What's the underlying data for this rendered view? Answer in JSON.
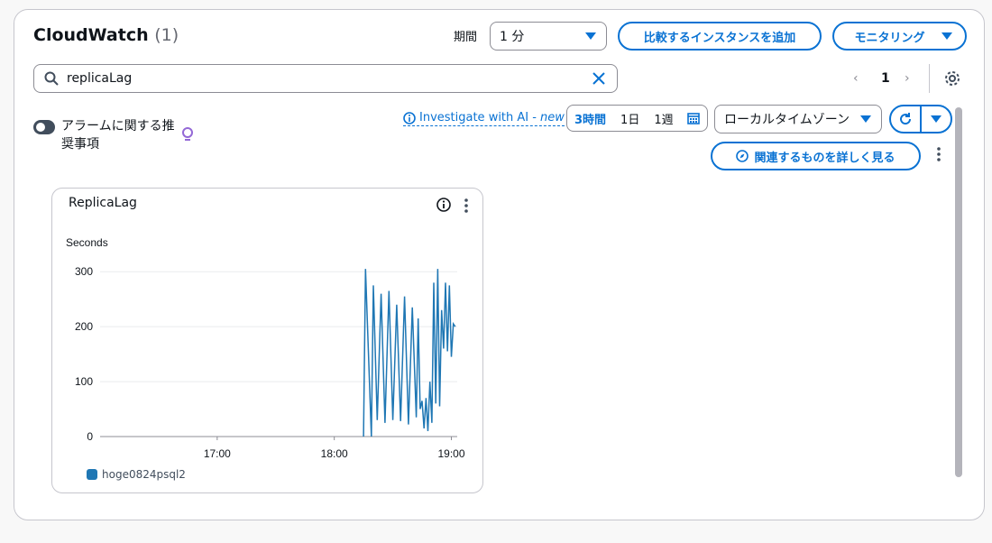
{
  "header": {
    "title": "CloudWatch",
    "count": "(1)",
    "period_label": "期間",
    "period_value": "1 分",
    "compare_button": "比較するインスタンスを追加",
    "monitoring_button": "モニタリング"
  },
  "search": {
    "value": "replicaLag"
  },
  "pagination": {
    "page": "1"
  },
  "recommendation_toggle": {
    "label": "アラームに関する推奨事項",
    "enabled": false
  },
  "ai_link": {
    "label": "Investigate with AI - ",
    "new": "new"
  },
  "time_range": {
    "options": [
      "3時間",
      "1日",
      "1週"
    ],
    "active": "3時間"
  },
  "timezone": {
    "value": "ローカルタイムゾーン"
  },
  "related_button": "関連するものを詳しく見る",
  "colors": {
    "accent": "#0972d3",
    "series": "#1f77b4"
  },
  "widget": {
    "title": "ReplicaLag",
    "unit_label": "Seconds"
  },
  "chart_data": {
    "type": "line",
    "ylabel": "Seconds",
    "ylim": [
      0,
      320
    ],
    "y_ticks": [
      0,
      100,
      200,
      300
    ],
    "x_ticks": [
      "17:00",
      "18:00",
      "19:00"
    ],
    "x_start": "16:00",
    "x_end": "19:03",
    "grid": true,
    "legend_position": "bottom-left",
    "series": [
      {
        "name": "hoge0824psql2",
        "x": [
          "18:15",
          "18:16",
          "18:19",
          "18:20",
          "18:22",
          "18:24",
          "18:26",
          "18:28",
          "18:30",
          "18:32",
          "18:34",
          "18:36",
          "18:38",
          "18:40",
          "18:42",
          "18:43",
          "18:44",
          "18:45",
          "18:46",
          "18:47",
          "18:48",
          "18:49",
          "18:50",
          "18:51",
          "18:52",
          "18:53",
          "18:54",
          "18:55",
          "18:56",
          "18:57",
          "18:58",
          "18:59",
          "19:00",
          "19:01",
          "19:02"
        ],
        "y": [
          0,
          305,
          0,
          275,
          30,
          260,
          25,
          265,
          30,
          240,
          28,
          255,
          22,
          235,
          35,
          215,
          50,
          65,
          15,
          70,
          10,
          100,
          25,
          280,
          60,
          305,
          55,
          230,
          160,
          280,
          155,
          275,
          145,
          205,
          200
        ]
      }
    ]
  }
}
